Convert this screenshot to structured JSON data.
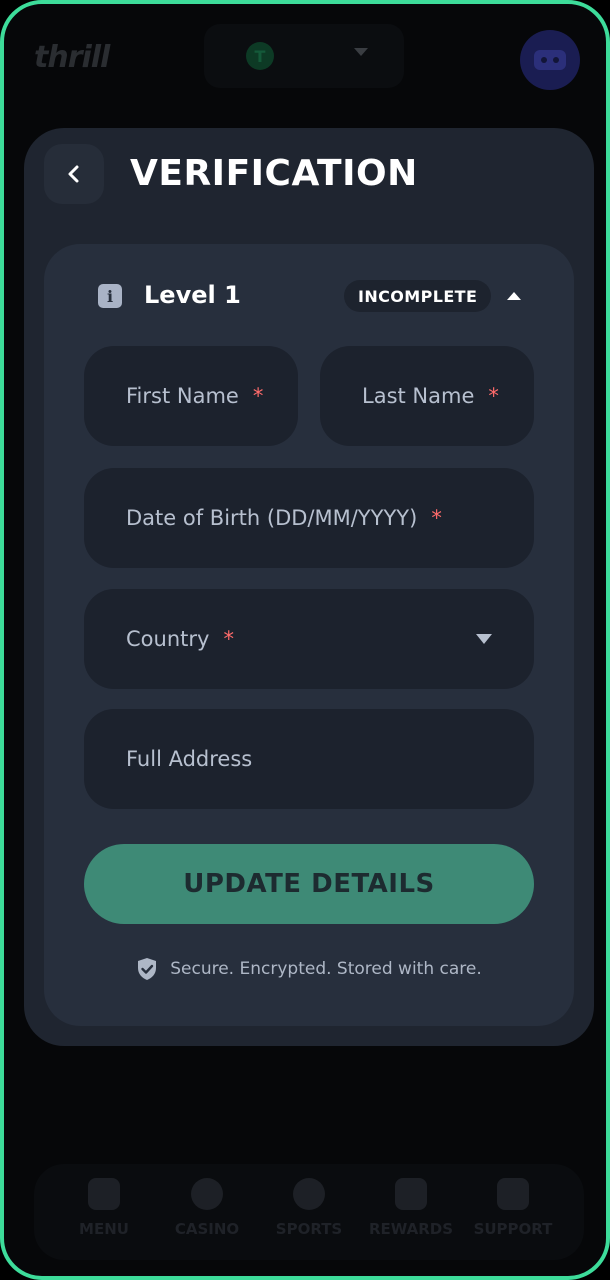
{
  "header": {
    "logo_text": "thrill",
    "wallet_coin_symbol": "T",
    "avatar_icon": "robot-avatar-icon"
  },
  "modal": {
    "title": "VERIFICATION",
    "back_icon": "chevron-left-icon"
  },
  "level": {
    "info_icon_glyph": "i",
    "title": "Level 1",
    "status": "INCOMPLETE",
    "expanded": true
  },
  "form": {
    "first_name_label": "First Name",
    "last_name_label": "Last Name",
    "dob_label": "Date of Birth (DD/MM/YYYY)",
    "country_label": "Country",
    "address_label": "Full Address",
    "required_mark": "*",
    "submit_label": "UPDATE DETAILS",
    "secure_note": "Secure. Encrypted. Stored with care."
  },
  "nav": {
    "items": [
      {
        "label": "MENU",
        "icon": "menu-icon"
      },
      {
        "label": "CASINO",
        "icon": "spade-icon"
      },
      {
        "label": "SPORTS",
        "icon": "soccer-ball-icon"
      },
      {
        "label": "REWARDS",
        "icon": "gift-icon"
      },
      {
        "label": "SUPPORT",
        "icon": "chat-icon"
      }
    ]
  },
  "colors": {
    "accent_border": "#3ddc9a",
    "button_bg": "#3e8a76",
    "required": "#ff6b6b",
    "panel_bg": "#1f2530",
    "card_bg": "#272f3d"
  }
}
